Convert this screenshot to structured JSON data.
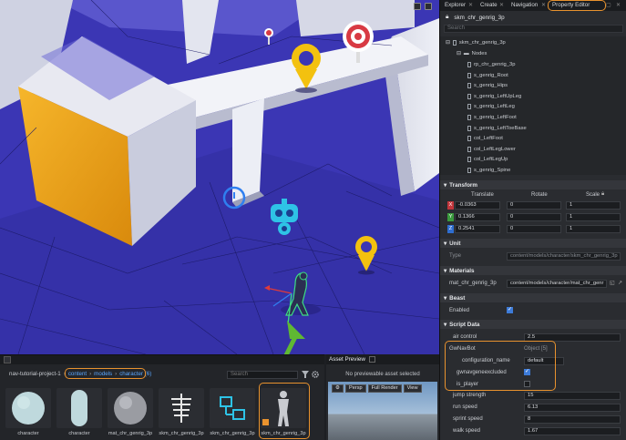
{
  "right_tabs": {
    "explorer": "Explorer",
    "create": "Create",
    "navigation": "Navigation",
    "property_editor": "Property Editor"
  },
  "property_editor": {
    "entity_name": "skm_chr_genrig_3p",
    "search_placeholder": "Search",
    "tree_root": "skm_chr_genrig_3p",
    "tree_nodes_label": "Nodes",
    "tree_items": [
      "rp_chr_genrig_3p",
      "s_genrig_Root",
      "s_genrig_Hips",
      "s_genrig_LeftUpLeg",
      "s_genrig_LeftLeg",
      "s_genrig_LeftFoot",
      "s_genrig_LeftToeBase",
      "col_LeftFoot",
      "col_LeftLegLower",
      "col_LeftLegUp",
      "s_genrig_Spine"
    ],
    "transform": {
      "title": "Transform",
      "col_translate": "Translate",
      "col_rotate": "Rotate",
      "col_scale": "Scale",
      "rows": [
        {
          "axis": "X",
          "translate": "-0.0363",
          "rotate": "0",
          "scale": "1"
        },
        {
          "axis": "Y",
          "translate": "0.1366",
          "rotate": "0",
          "scale": "1"
        },
        {
          "axis": "Z",
          "translate": "0.2541",
          "rotate": "0",
          "scale": "1"
        }
      ]
    },
    "unit": {
      "title": "Unit",
      "type_label": "Type",
      "type_value": "content/models/character/skm_chr_genrig_3p"
    },
    "materials": {
      "title": "Materials",
      "material_name": "mat_chr_genrig_3p",
      "material_path": "content/models/character/mat_chr_genr"
    },
    "beast": {
      "title": "Beast",
      "enabled_label": "Enabled",
      "enabled": true
    },
    "script_data": {
      "title": "Script Data",
      "air_control_label": "air control",
      "air_control": "2.5",
      "gwnavbot_label": "GwNavBot",
      "gwnavbot_type": "Object [5]",
      "configuration_name_label": "configuration_name",
      "configuration_name": "default",
      "gwnavgeneexcluded_label": "gwnavgeneexcluded",
      "gwnavgeneexcluded": true,
      "is_player_label": "is_player",
      "is_player": false,
      "jump_strength_label": "jump strength",
      "jump_strength": "15",
      "run_speed_label": "run speed",
      "run_speed": "6.13",
      "sprint_speed_label": "sprint speed",
      "sprint_speed": "8",
      "walk_speed_label": "walk speed",
      "walk_speed": "1.67"
    }
  },
  "asset_browser": {
    "project": "nav-tutorial-project-1",
    "breadcrumb": [
      "content",
      "models",
      "character (6)"
    ],
    "search_placeholder": "Search",
    "assets": [
      {
        "label": "character"
      },
      {
        "label": "character"
      },
      {
        "label": "mat_chr_genrig_3p"
      },
      {
        "label": "skm_chr_genrig_3p"
      },
      {
        "label": "skm_chr_genrig_3p"
      },
      {
        "label": "skm_chr_genrig_3p"
      }
    ]
  },
  "asset_preview": {
    "title": "Asset Preview",
    "message": "No previewable asset selected",
    "persp": "Persp",
    "render_mode": "Full Render",
    "view": "View"
  },
  "colors": {
    "navmesh": "#3c35b8",
    "highlight": "#e8922e",
    "annotation_arrow": "#5fb833",
    "link": "#5aa7ff",
    "marker_yellow": "#f3c10f",
    "target_red": "#d83a43"
  }
}
